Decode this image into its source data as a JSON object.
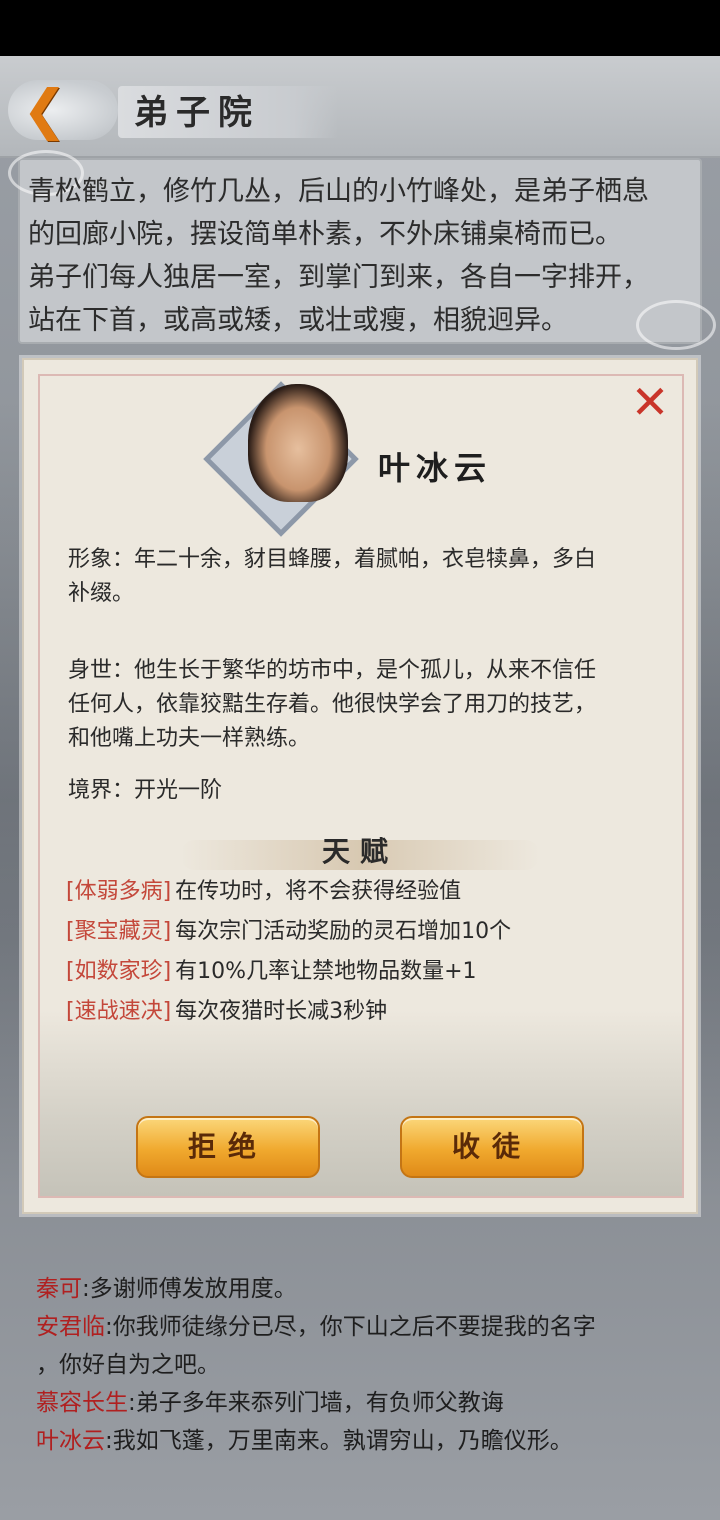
{
  "header": {
    "title": "弟子院",
    "back_icon": "back-arrow-icon"
  },
  "description": {
    "lines": [
      "青松鹤立，修竹几丛，后山的小竹峰处，是弟子栖息",
      "的回廊小院，摆设简单朴素，不外床铺桌椅而已。",
      "弟子们每人独居一室，到掌门到来，各自一字排开，",
      "站在下首，或高或矮，或壮或瘦，相貌迥异。"
    ]
  },
  "dialog": {
    "name": "叶冰云",
    "appearance": [
      "形象：年二十余，豺目蜂腰，着腻帕，衣皂犊鼻，多白",
      "补缀。"
    ],
    "background": [
      "身世：他生长于繁华的坊市中，是个孤儿，从来不信任",
      "任何人，依靠狡黠生存着。他很快学会了用刀的技艺，",
      "和他嘴上功夫一样熟练。"
    ],
    "realm": "境界：开光一阶",
    "talent_title": "天赋",
    "talents": [
      {
        "tag": "[体弱多病]",
        "effect": "在传功时，将不会获得经验值"
      },
      {
        "tag": "[聚宝藏灵]",
        "effect": "每次宗门活动奖励的灵石增加10个"
      },
      {
        "tag": "[如数家珍]",
        "effect": "有10%几率让禁地物品数量+1"
      },
      {
        "tag": "[速战速决]",
        "effect": "每次夜猎时长减3秒钟"
      }
    ],
    "reject_label": "拒绝",
    "accept_label": "收徒",
    "colors": {
      "accent": "#c4473a",
      "button": "#f0a92e",
      "close": "#c9352a"
    }
  },
  "chat": [
    {
      "who": "秦可",
      "text": ":多谢师傅发放用度。"
    },
    {
      "who": "安君临",
      "text": ":你我师徒缘分已尽，你下山之后不要提我的名字"
    },
    {
      "who": "",
      "text": "，你好自为之吧。"
    },
    {
      "who": "慕容长生",
      "text": ":弟子多年来忝列门墙，有负师父教诲"
    },
    {
      "who": "叶冰云",
      "text": ":我如飞蓬，万里南来。孰谓穷山，乃瞻仪形。"
    }
  ]
}
